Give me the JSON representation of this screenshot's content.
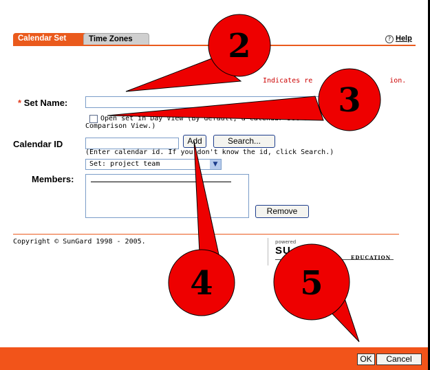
{
  "tabs": [
    {
      "label": "Calendar Set",
      "active": true
    },
    {
      "label": "Time Zones",
      "active": false
    }
  ],
  "help": {
    "icon": "?",
    "label": "Help"
  },
  "required_note": "Indicates re",
  "required_note_tail": "ion.",
  "form": {
    "set_name_label": "Set Name:",
    "required_marker": "*",
    "set_name_value": "",
    "day_view_checked": false,
    "day_view_text_1": "Open set in Day View (By default, a calendar set o",
    "day_view_text_2": "Comparison View.)",
    "calendar_id_label": "Calendar ID",
    "calendar_id_value": "",
    "add_label": "Add",
    "search_label": "Search...",
    "calendar_id_hint": "(Enter calendar id. If you don't know the id, click Search.)",
    "set_select_value": "Set: project team",
    "members_label": "Members:",
    "remove_label": "Remove"
  },
  "footer_text": {
    "copyright": "Copyright © SunGard 1998 - 2005.",
    "powered": "powered",
    "logo": "SU",
    "logo_tail": "EDUCATION"
  },
  "footer_buttons": {
    "ok": "OK",
    "cancel": "Cancel"
  },
  "callouts": [
    "2",
    "3",
    "4",
    "5"
  ],
  "colors": {
    "accent": "#ea5a1c",
    "footer": "#f2541a",
    "callout_fill": "#ee0000"
  }
}
